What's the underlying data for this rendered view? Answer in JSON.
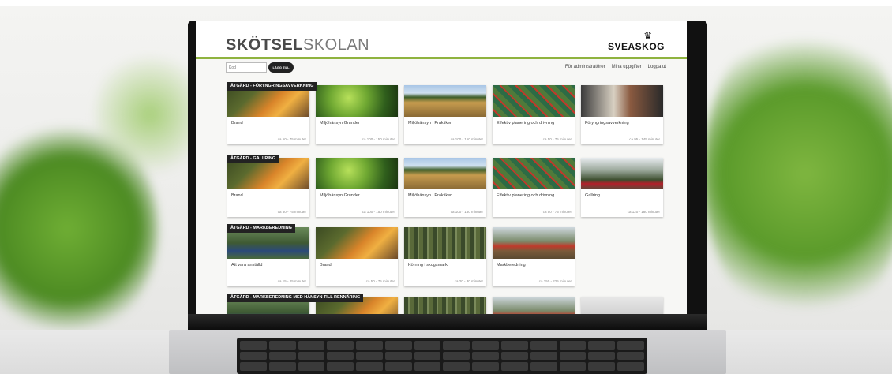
{
  "site": {
    "logo_bold": "SKÖTSEL",
    "logo_light": "SKOLAN",
    "brand": "SVEASKOG",
    "brand_icon": "crown-icon"
  },
  "toolbar": {
    "code_placeholder": "Kod",
    "add_button": "LÄGG TILL",
    "links": [
      "För administratörer",
      "Mina uppgifter",
      "Logga ut"
    ]
  },
  "sections": [
    {
      "label": "ÅTGÄRD - FÖRYNGRINGSAVVERKNING",
      "cards": [
        {
          "title": "Brand",
          "time": "ca 50 - 75 minuter",
          "image": "fire"
        },
        {
          "title": "Miljöhänsyn Grunder",
          "time": "ca 100 - 150 minuter",
          "image": "leaf"
        },
        {
          "title": "Miljöhänsyn i Praktiken",
          "time": "ca 100 - 150 minuter",
          "image": "bog"
        },
        {
          "title": "Effektiv planering och drivning",
          "time": "ca 50 - 75 minuter",
          "image": "plan"
        },
        {
          "title": "Föryngringsavverkning",
          "time": "ca 95 - 145 minuter",
          "image": "cab"
        }
      ]
    },
    {
      "label": "ÅTGÄRD - GALLRING",
      "cards": [
        {
          "title": "Brand",
          "time": "ca 50 - 75 minuter",
          "image": "fire"
        },
        {
          "title": "Miljöhänsyn Grunder",
          "time": "ca 100 - 150 minuter",
          "image": "leaf"
        },
        {
          "title": "Miljöhänsyn i Praktiken",
          "time": "ca 100 - 150 minuter",
          "image": "bog"
        },
        {
          "title": "Effektiv planering och drivning",
          "time": "ca 50 - 75 minuter",
          "image": "plan"
        },
        {
          "title": "Gallring",
          "time": "ca 120 - 180 minuter",
          "image": "harv"
        }
      ]
    },
    {
      "label": "ÅTGÄRD - MARKBEREDNING",
      "cards": [
        {
          "title": "Att vara anställd",
          "time": "ca 15 - 25 minuter",
          "image": "people"
        },
        {
          "title": "Brand",
          "time": "ca 50 - 75 minuter",
          "image": "fire"
        },
        {
          "title": "Körning i skogsmark",
          "time": "ca 20 - 30 minuter",
          "image": "forest"
        },
        {
          "title": "Markberedning",
          "time": "ca 150 - 225 minuter",
          "image": "field"
        }
      ]
    },
    {
      "label": "ÅTGÄRD - MARKBEREDNING MED HÄNSYN TILL RENNÄRING",
      "cards": [
        {
          "title": "",
          "time": "",
          "image": "people"
        },
        {
          "title": "",
          "time": "",
          "image": "fire"
        },
        {
          "title": "",
          "time": "",
          "image": "forest"
        },
        {
          "title": "",
          "time": "",
          "image": "field"
        },
        {
          "title": "",
          "time": "",
          "image": "reindeer"
        }
      ]
    }
  ]
}
